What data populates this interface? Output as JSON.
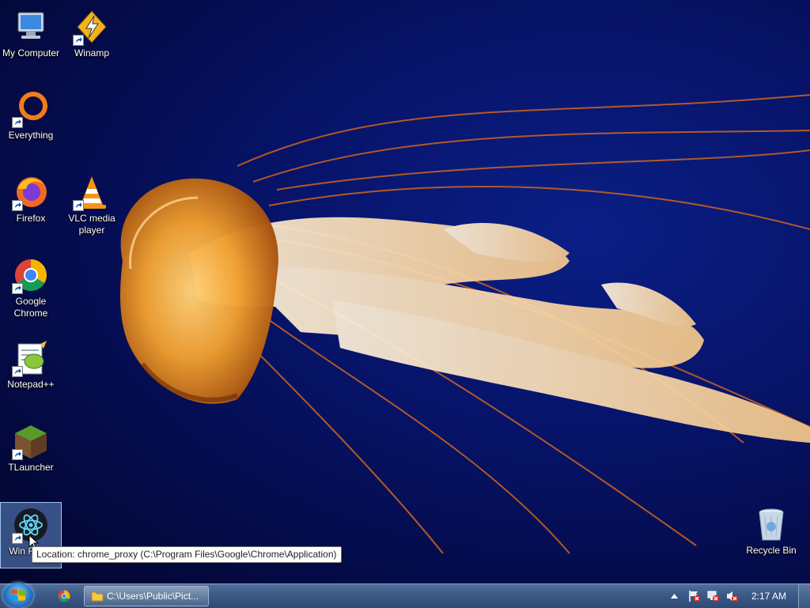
{
  "desktop": {
    "icons": [
      {
        "label": "My Computer",
        "icon": "computer-icon"
      },
      {
        "label": "Winamp",
        "icon": "winamp-icon"
      },
      {
        "label": "Everything",
        "icon": "everything-icon"
      },
      {
        "label": "Firefox",
        "icon": "firefox-icon"
      },
      {
        "label": "VLC media player",
        "icon": "vlc-icon"
      },
      {
        "label": "Google Chrome",
        "icon": "chrome-icon"
      },
      {
        "label": "Notepad++",
        "icon": "notepad-plus-plus-icon"
      },
      {
        "label": "TLauncher",
        "icon": "tlauncher-icon"
      },
      {
        "label": "Win React",
        "icon": "react-icon"
      },
      {
        "label": "Recycle Bin",
        "icon": "recycle-bin-icon"
      }
    ],
    "tooltip": "Location: chrome_proxy (C:\\Program Files\\Google\\Chrome\\Application)"
  },
  "taskbar": {
    "explorer_label": "C:\\Users\\Public\\Pict...",
    "clock": "2:17 AM"
  }
}
